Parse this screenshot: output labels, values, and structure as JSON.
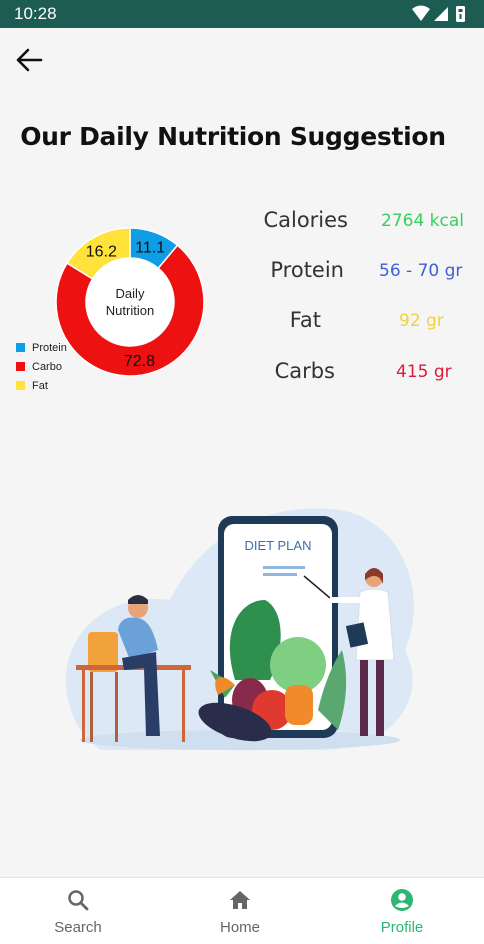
{
  "status_bar": {
    "time": "10:28",
    "icons": [
      "wifi-icon",
      "signal-icon",
      "battery-icon"
    ]
  },
  "header": {
    "back_icon": "arrow-left-icon",
    "title": "Our Daily Nutrition Suggestion"
  },
  "chart_data": {
    "type": "pie",
    "center_label": "Daily\nNutrition",
    "slices": [
      {
        "name": "Protein",
        "value": 11.1,
        "color": "#0f9de5"
      },
      {
        "name": "Carbo",
        "value": 72.8,
        "color": "#ee1111"
      },
      {
        "name": "Fat",
        "value": 16.2,
        "color": "#ffe23a"
      }
    ],
    "legend_position": "bottom-left"
  },
  "nutrients": [
    {
      "label": "Calories",
      "value": "2764 kcal",
      "color": "#35d05e"
    },
    {
      "label": "Protein",
      "value": "56 - 70 gr",
      "color": "#3f5fd8"
    },
    {
      "label": "Fat",
      "value": "92 gr",
      "color": "#f2d13a"
    },
    {
      "label": "Carbs",
      "value": "415 gr",
      "color": "#e01a3b"
    }
  ],
  "illustration": {
    "sign_text": "DIET PLAN"
  },
  "bottom_nav": {
    "items": [
      {
        "label": "Search",
        "icon": "search-icon",
        "active": false
      },
      {
        "label": "Home",
        "icon": "home-icon",
        "active": false
      },
      {
        "label": "Profile",
        "icon": "profile-icon",
        "active": true
      }
    ],
    "active_color": "#2bb673",
    "inactive_color": "#666666"
  }
}
